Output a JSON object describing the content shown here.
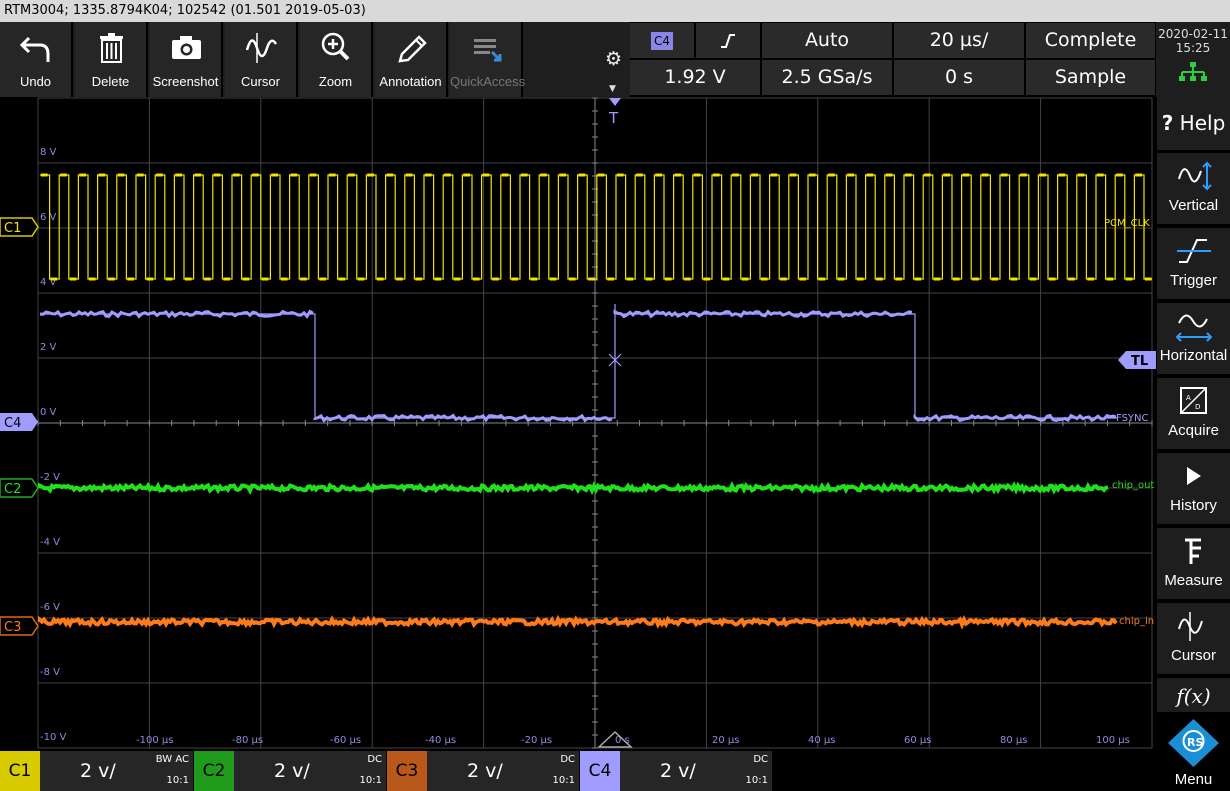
{
  "titlebar": {
    "text": "RTM3004; 1335.8794K04; 102542 (01.501 2019-05-03)"
  },
  "toolbar": {
    "items": [
      {
        "label": "Undo",
        "icon": "undo-icon"
      },
      {
        "label": "Delete",
        "icon": "trash-icon"
      },
      {
        "label": "Screenshot",
        "icon": "camera-icon"
      },
      {
        "label": "Cursor",
        "icon": "cursor-wave-icon"
      },
      {
        "label": "Zoom",
        "icon": "zoom-icon"
      },
      {
        "label": "Annotation",
        "icon": "pencil-icon"
      },
      {
        "label": "QuickAccess",
        "icon": "quickaccess-icon",
        "disabled": true
      }
    ]
  },
  "trigger_info": {
    "source": "C4",
    "slope_icon": "rising-edge-icon",
    "mode": "Auto",
    "timebase": "20 µs/",
    "acq_state": "Complete",
    "level": "1.92 V",
    "sample_rate": "2.5 GSa/s",
    "offset": "0 s",
    "acq_mode": "Sample"
  },
  "datetime": {
    "date": "2020-02-11",
    "time": "15:25"
  },
  "plot": {
    "y_labels": [
      "8 V",
      "6 V",
      "4 V",
      "2 V",
      "0 V",
      "-2 V",
      "-4 V",
      "-6 V",
      "-8 V",
      "-10 V"
    ],
    "x_labels": [
      "-100 µs",
      "-80 µs",
      "-60 µs",
      "-40 µs",
      "-20 µs",
      "0 s",
      "20 µs",
      "40 µs",
      "60 µs",
      "80 µs",
      "100 µs"
    ],
    "trigger_marker": "T",
    "trigger_level_marker": "TL",
    "channels": [
      {
        "id": "C1",
        "color": "#f5e400",
        "name": "PCM_CLK"
      },
      {
        "id": "C4",
        "color": "#a09cff",
        "name": "FSYNC"
      },
      {
        "id": "C2",
        "color": "#22e01e",
        "name": "chip_out"
      },
      {
        "id": "C3",
        "color": "#ff7a1a",
        "name": "chip_in"
      }
    ]
  },
  "right_menu": [
    {
      "label": "Help",
      "icon": "help-icon"
    },
    {
      "label": "Vertical",
      "icon": "vertical-icon"
    },
    {
      "label": "Trigger",
      "icon": "trigger-icon"
    },
    {
      "label": "Horizontal",
      "icon": "horizontal-icon"
    },
    {
      "label": "Acquire",
      "icon": "acquire-icon"
    },
    {
      "label": "History",
      "icon": "history-icon"
    },
    {
      "label": "Measure",
      "icon": "measure-icon"
    },
    {
      "label": "Cursor",
      "icon": "cursor-icon"
    },
    {
      "label": "f(x)",
      "icon": "function-icon"
    },
    {
      "label": "Menu",
      "icon": "rs-logo-icon"
    }
  ],
  "channel_bar": [
    {
      "id": "C1",
      "scale": "2 v/",
      "coupling": "AC",
      "bw": "BW",
      "ratio": "10:1",
      "color": "#f5e400",
      "textcolor": "#000"
    },
    {
      "id": "C2",
      "scale": "2 v/",
      "coupling": "DC",
      "bw": "",
      "ratio": "10:1",
      "color": "#1f9a1a",
      "textcolor": "#000"
    },
    {
      "id": "C3",
      "scale": "2 v/",
      "coupling": "DC",
      "bw": "",
      "ratio": "10:1",
      "color": "#b8581a",
      "textcolor": "#000"
    },
    {
      "id": "C4",
      "scale": "2 v/",
      "coupling": "DC",
      "bw": "",
      "ratio": "10:1",
      "color": "#a09cff",
      "textcolor": "#000"
    }
  ]
}
